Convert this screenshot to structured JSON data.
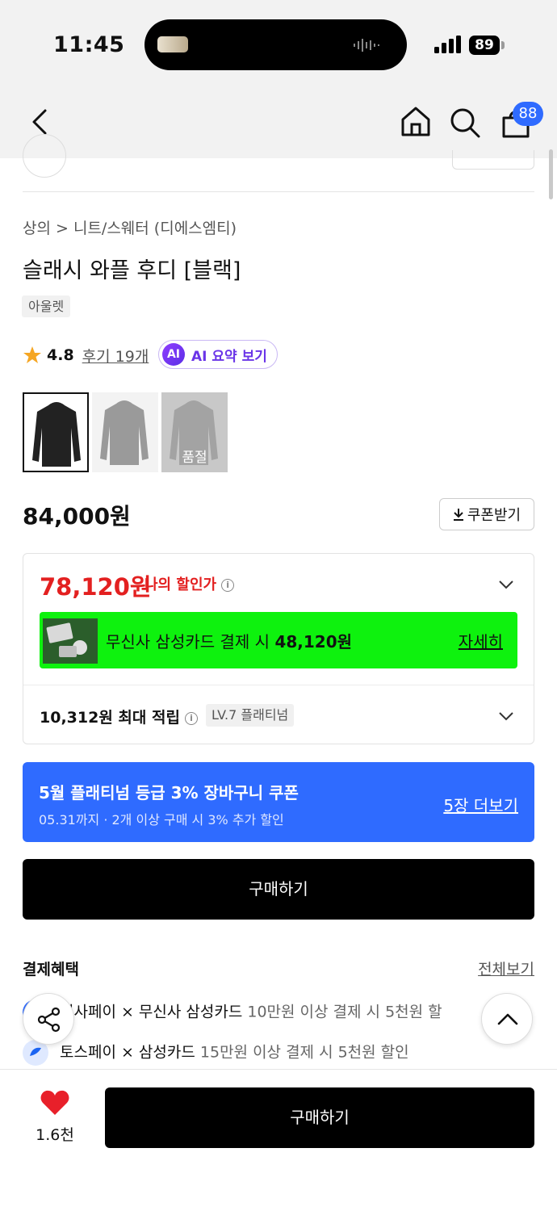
{
  "status_bar": {
    "time": "11:45",
    "battery": "89"
  },
  "nav": {
    "cart_badge": "88"
  },
  "product": {
    "breadcrumb": "상의 > 니트/스웨터 (디에스엠티)",
    "title": "슬래시 와플 후디 [블랙]",
    "tag": "아울렛",
    "rating": "4.8",
    "reviews": "후기 19개",
    "ai_summary": "AI 요약 보기",
    "ai_badge": "AI",
    "swatches": [
      {
        "color": "#222222",
        "selected": true,
        "label": ""
      },
      {
        "color": "#9a9a9a",
        "selected": false,
        "label": ""
      },
      {
        "color": "#a3a3a3",
        "selected": false,
        "label": "품절"
      }
    ],
    "price": "84,000원",
    "coupon_button": "쿠폰받기"
  },
  "discount": {
    "my_price": "78,120원",
    "my_price_label": "나의 할인가",
    "card_text": "무신사 삼성카드 결제 시",
    "card_price": "48,120원",
    "card_detail": "자세히",
    "points": "10,312원 최대 적립",
    "level": "LV.7 플래티넘"
  },
  "promo": {
    "title": "5월 플래티넘 등급 3% 장바구니 쿠폰",
    "subtitle": "05.31까지 · 2개 이상 구매 시 3% 추가 할인",
    "link": "5장 더보기",
    "color": "#2f6bff"
  },
  "buy_button": "구매하기",
  "benefits": {
    "title": "결제혜택",
    "view_all": "전체보기",
    "items": [
      {
        "name": "신사페이 × 무신사 삼성카드",
        "detail": "10만원 이상 결제 시 5천원 할"
      },
      {
        "name": "토스페이 × 삼성카드",
        "detail": "15만원 이상 결제 시 5천원 할인"
      }
    ]
  },
  "bottom_bar": {
    "likes": "1.6천",
    "buy_label": "구매하기"
  },
  "colors": {
    "accent_red": "#e32020",
    "card_green": "#0ef20e",
    "brand_blue": "#2f6bff"
  }
}
